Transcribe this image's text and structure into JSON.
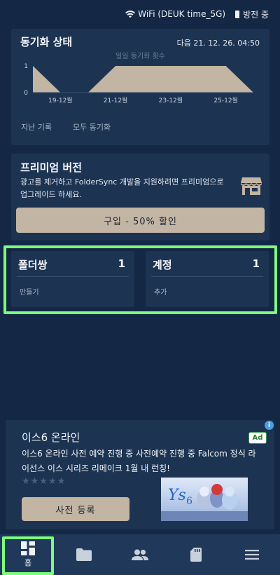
{
  "status_bar": {
    "wifi_text": "WiFi (DEUK time_5G)",
    "battery_text": "방전 중",
    "icons": [
      "wifi-icon",
      "battery-icon"
    ]
  },
  "sync_status": {
    "title": "동기화 상태",
    "next_sync": "다음 21. 12. 26. 04:50",
    "actions": [
      "지난 기록",
      "모두 동기화"
    ]
  },
  "chart_data": {
    "type": "area",
    "title": "일일 동기화 횟수",
    "x_ticks": [
      "19-12월",
      "21-12월",
      "23-12월",
      "25-12월"
    ],
    "x": [
      "18-12",
      "19-12",
      "20-12",
      "21-12",
      "22-12",
      "23-12",
      "24-12",
      "25-12",
      "26-12"
    ],
    "values": [
      1,
      0,
      0,
      1,
      1,
      1,
      1,
      1,
      0
    ],
    "y_ticks": [
      "0",
      "1"
    ],
    "ylim": [
      0,
      1
    ],
    "grid": false,
    "fill_color": "#c3b5a3"
  },
  "premium": {
    "title": "프리미엄 버전",
    "description": "광고를 제거하고 FolderSync 개발을 지원하려면 프리미엄으로 업그레이드 하세요.",
    "buy_label": "구입 - 50% 할인",
    "icon": "store-icon"
  },
  "folder_pairs": {
    "title": "폴더쌍",
    "count": "1",
    "action": "만들기"
  },
  "accounts": {
    "title": "계정",
    "count": "1",
    "action": "추가"
  },
  "ad": {
    "info_icon_label": "i",
    "badge": "Ad",
    "title": "이스6 온라인",
    "description": "이스6 온라인 사전 예약 진행 중 사전예약 진행 중 Falcom 정식 라이선스 이스 시리즈 리메이크 1월 내 런칭!",
    "stars": "★★★★★",
    "rating": 0,
    "cta_label": "사전 등록"
  },
  "bottom_nav": {
    "home_label": "홈",
    "items": [
      "home-icon",
      "folder-icon",
      "accounts-icon",
      "sd-card-icon",
      "menu-icon"
    ]
  },
  "colors": {
    "background": "#142845",
    "card": "#1c3452",
    "accent": "#c3b5a3",
    "highlight": "#7dfc7d"
  }
}
